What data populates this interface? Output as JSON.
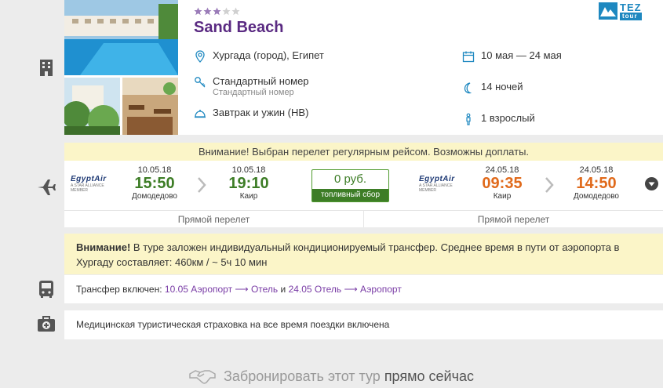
{
  "hotel": {
    "name": "Sand Beach",
    "stars_filled": 3,
    "stars_total": 5,
    "location": "Хургада (город), Египет",
    "room_type": "Стандартный номер",
    "room_type_sub": "Стандартный номер",
    "meal": "Завтрак и ужин (НВ)",
    "dates": "10 мая — 24 мая",
    "nights": "14 ночей",
    "guests": "1 взрослый"
  },
  "operator_logo": {
    "line1": "TEZ",
    "line2": "tour"
  },
  "flights": {
    "notice": "Внимание! Выбран перелет регулярным рейсом. Возможны доплаты.",
    "outbound": {
      "airline": "EgyptAir",
      "airline_tag": "A STAR ALLIANCE MEMBER",
      "dep_date": "10.05.18",
      "dep_time": "15:50",
      "dep_city": "Домодедово",
      "arr_date": "10.05.18",
      "arr_time": "19:10",
      "arr_city": "Каир",
      "type": "Прямой перелет"
    },
    "price": "0 руб.",
    "fee_label": "топливный сбор",
    "return": {
      "airline": "EgyptAir",
      "airline_tag": "A STAR ALLIANCE MEMBER",
      "dep_date": "24.05.18",
      "dep_time": "09:35",
      "dep_city": "Каир",
      "arr_date": "24.05.18",
      "arr_time": "14:50",
      "arr_city": "Домодедово",
      "type": "Прямой перелет"
    }
  },
  "transfer_warning": {
    "label": "Внимание!",
    "text": " В туре заложен индивидуальный кондиционируемый трансфер. Среднее время в пути от аэропорта в Хургаду составляет: 460км / ~ 5ч 10 мин"
  },
  "transfer": {
    "prefix": "Трансфер включен: ",
    "leg1": "10.05 Аэропорт ⟶ Отель",
    "joiner": " и ",
    "leg2": "24.05 Отель ⟶ Аэропорт"
  },
  "insurance": "Медицинская туристическая страховка на все время поездки включена",
  "booking": {
    "text_light": "Забронировать этот тур ",
    "text_strong": "прямо сейчас"
  },
  "colors": {
    "hotel_name": "#5a2a82",
    "accent_blue": "#1e88c0",
    "time_green": "#3d7d26",
    "time_orange": "#e06a1b",
    "notice_bg": "#fbf5c8"
  }
}
